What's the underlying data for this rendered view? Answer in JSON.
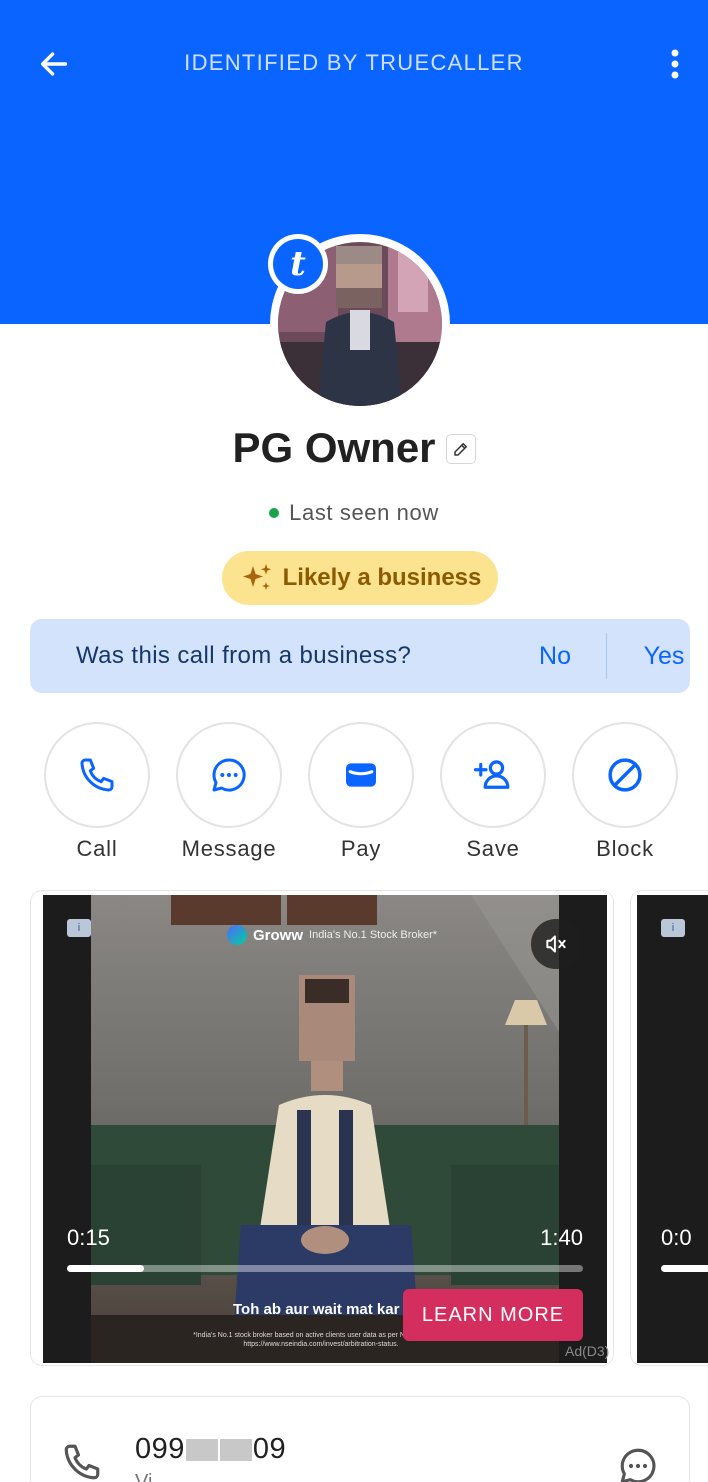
{
  "header": {
    "title": "IDENTIFIED BY TRUECALLER",
    "bg_color": "#0a64ff"
  },
  "profile": {
    "name": "PG Owner",
    "badge_letter": "t",
    "status": "Last seen now",
    "status_color": "#1aa34a",
    "business_pill": "Likely a business"
  },
  "question": {
    "text": "Was this call from a business?",
    "no": "No",
    "yes": "Yes"
  },
  "actions": [
    {
      "label": "Call",
      "icon": "phone-icon"
    },
    {
      "label": "Message",
      "icon": "chat-bubble-icon"
    },
    {
      "label": "Pay",
      "icon": "wallet-icon"
    },
    {
      "label": "Save",
      "icon": "add-person-icon"
    },
    {
      "label": "Block",
      "icon": "block-icon"
    }
  ],
  "ad": {
    "brand": "Groww",
    "tagline": "India's No.1 Stock Broker*",
    "current_time": "0:15",
    "duration": "1:40",
    "progress": 0.15,
    "caption": "Toh ab aur wait mat kar",
    "fine_print": "*India's No.1 stock broker based on active clients user data as per NSE at... Refer: https://www.nseindia.com/invest/arbitration-status.",
    "cta": "LEARN MORE",
    "label": "Ad(D3)",
    "next_time": "0:0"
  },
  "contact": {
    "number_prefix": "099",
    "number_suffix": "09",
    "type": "Vi..."
  }
}
